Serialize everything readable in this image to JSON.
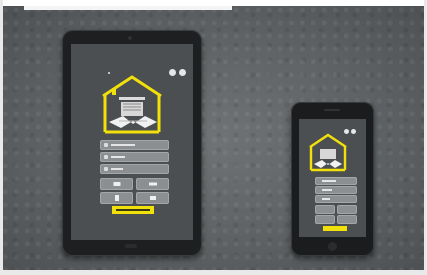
{
  "scene": {
    "description_colors": {
      "background": "#5e6264",
      "device_body": "#1d1f20",
      "screen": "#4c4f51",
      "accent": "#f2e00b",
      "control": "#8b8f91"
    },
    "devices": [
      {
        "kind": "tablet",
        "icon": "tablet-icon"
      },
      {
        "kind": "phone",
        "icon": "phone-icon"
      }
    ]
  }
}
